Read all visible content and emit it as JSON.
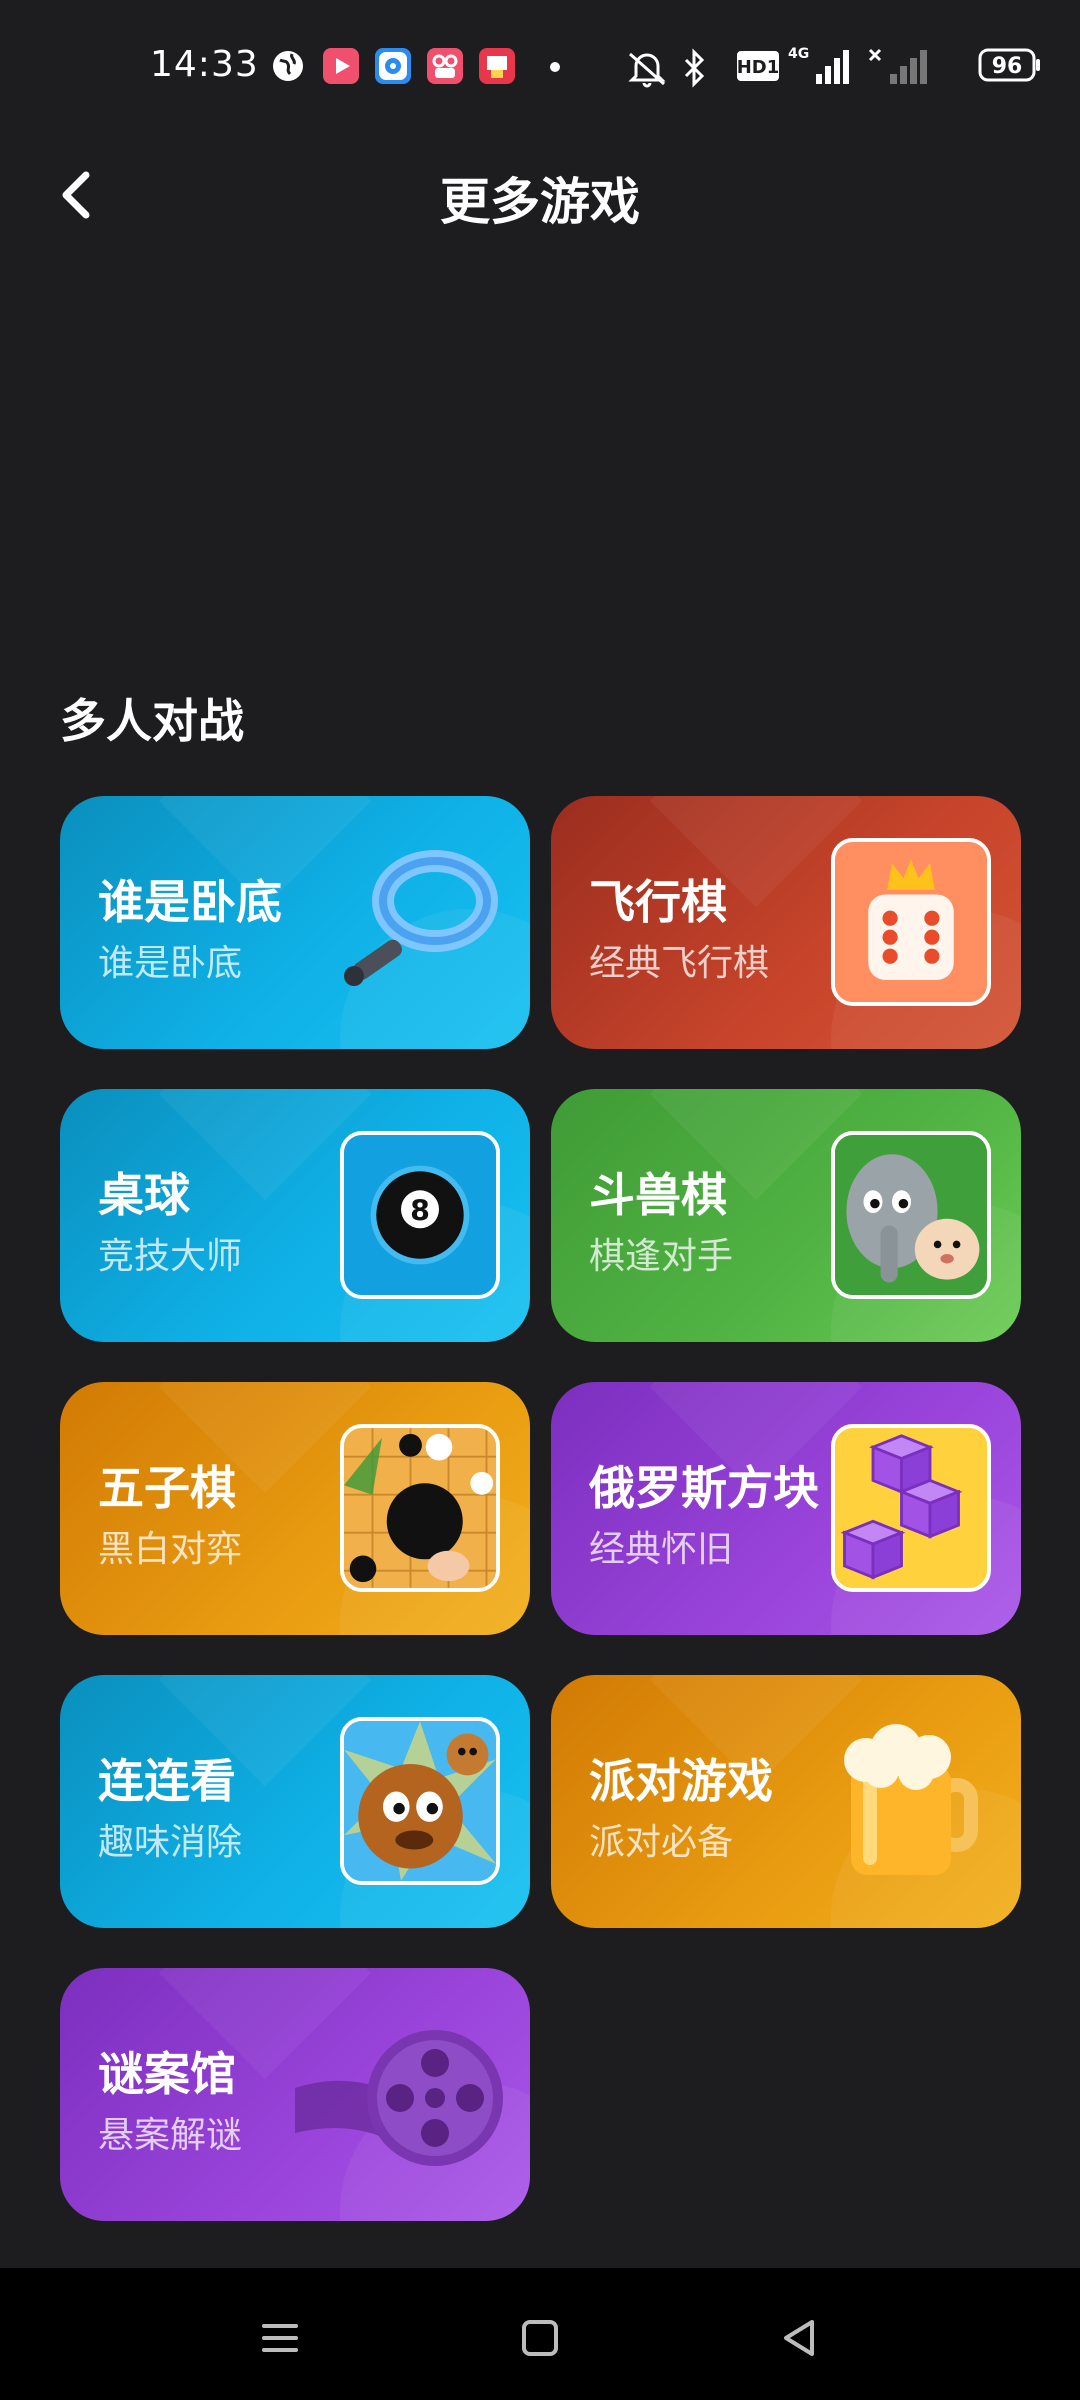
{
  "status_bar": {
    "time": "14:33",
    "battery": "96",
    "network": "4G",
    "hd_badge": "HD1",
    "app_icons": [
      "globe-icon",
      "video-app-icon",
      "browser-app-icon",
      "camera-app-icon",
      "shop-app-icon"
    ],
    "system_icons": [
      "mute-icon",
      "bluetooth-icon",
      "hd-icon",
      "signal-4g-icon",
      "signal-no-service-icon",
      "battery-icon"
    ]
  },
  "header": {
    "title": "更多游戏",
    "back_icon": "chevron-left-icon"
  },
  "section": {
    "title": "多人对战"
  },
  "games": [
    {
      "name": "谁是卧底",
      "subtitle": "谁是卧底",
      "color": "#0fb0e6",
      "icon": "magnifier-icon"
    },
    {
      "name": "飞行棋",
      "subtitle": "经典飞行棋",
      "color": "#c8452b",
      "icon": "dice-crown-icon"
    },
    {
      "name": "桌球",
      "subtitle": "竞技大师",
      "color": "#0fb0e6",
      "icon": "eight-ball-icon"
    },
    {
      "name": "斗兽棋",
      "subtitle": "棋逢对手",
      "color": "#52b444",
      "icon": "elephant-icon"
    },
    {
      "name": "五子棋",
      "subtitle": "黑白对弈",
      "color": "#e99c11",
      "icon": "go-stones-icon"
    },
    {
      "name": "俄罗斯方块",
      "subtitle": "经典怀旧",
      "color": "#9a44db",
      "icon": "purple-cubes-icon"
    },
    {
      "name": "连连看",
      "subtitle": "趣味消除",
      "color": "#0fb0e6",
      "icon": "cartoon-dog-icon"
    },
    {
      "name": "派对游戏",
      "subtitle": "派对必备",
      "color": "#e99c11",
      "icon": "beer-mug-icon"
    },
    {
      "name": "谜案馆",
      "subtitle": "悬案解谜",
      "color": "#9a44db",
      "icon": "film-reel-icon"
    }
  ],
  "nav_bar": {
    "icons": [
      "menu-icon",
      "home-square-icon",
      "back-triangle-icon"
    ]
  }
}
